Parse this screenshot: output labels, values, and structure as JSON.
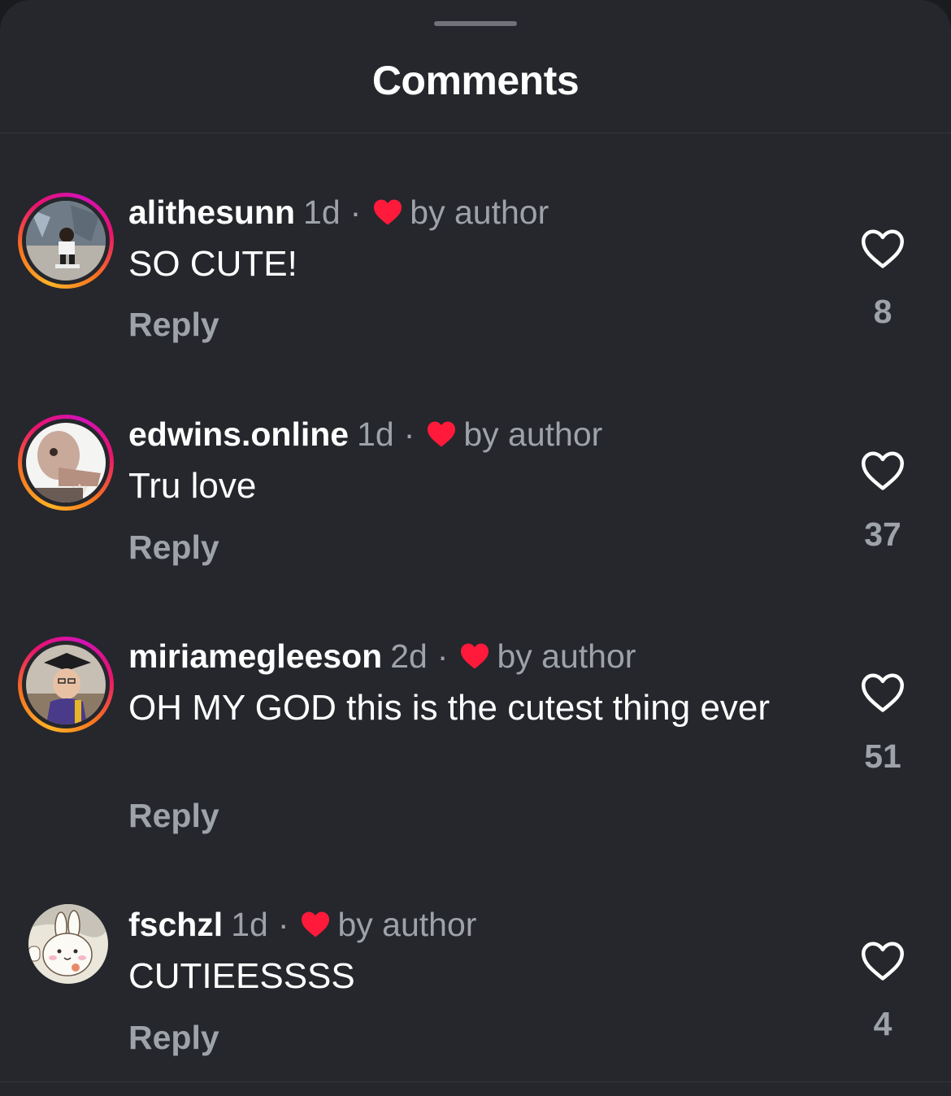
{
  "header": {
    "title": "Comments"
  },
  "comments": [
    {
      "username": "alithesunn",
      "time": "1d",
      "separator": "·",
      "liked_by": "by author",
      "text": "SO CUTE!",
      "reply_label": "Reply",
      "likes": "8",
      "has_story_ring": true
    },
    {
      "username": "edwins.online",
      "time": "1d",
      "separator": "·",
      "liked_by": "by author",
      "text": "Tru love",
      "reply_label": "Reply",
      "likes": "37",
      "has_story_ring": true
    },
    {
      "username": "miriamegleeson",
      "time": "2d",
      "separator": "·",
      "liked_by": "by author",
      "text": "OH MY GOD this is the cutest thing ever",
      "reply_label": "Reply",
      "likes": "51",
      "has_story_ring": true
    },
    {
      "username": "fschzl",
      "time": "1d",
      "separator": "·",
      "liked_by": "by author",
      "text": "CUTIEESSSS",
      "reply_label": "Reply",
      "likes": "4",
      "has_story_ring": false
    }
  ],
  "colors": {
    "background": "#25272c",
    "primary_text": "#ffffff",
    "secondary_text": "#9ea2a9",
    "author_heart": "#ff1a3c"
  },
  "icons": {
    "author_heart": "heart-filled-icon",
    "like": "heart-outline-icon"
  }
}
